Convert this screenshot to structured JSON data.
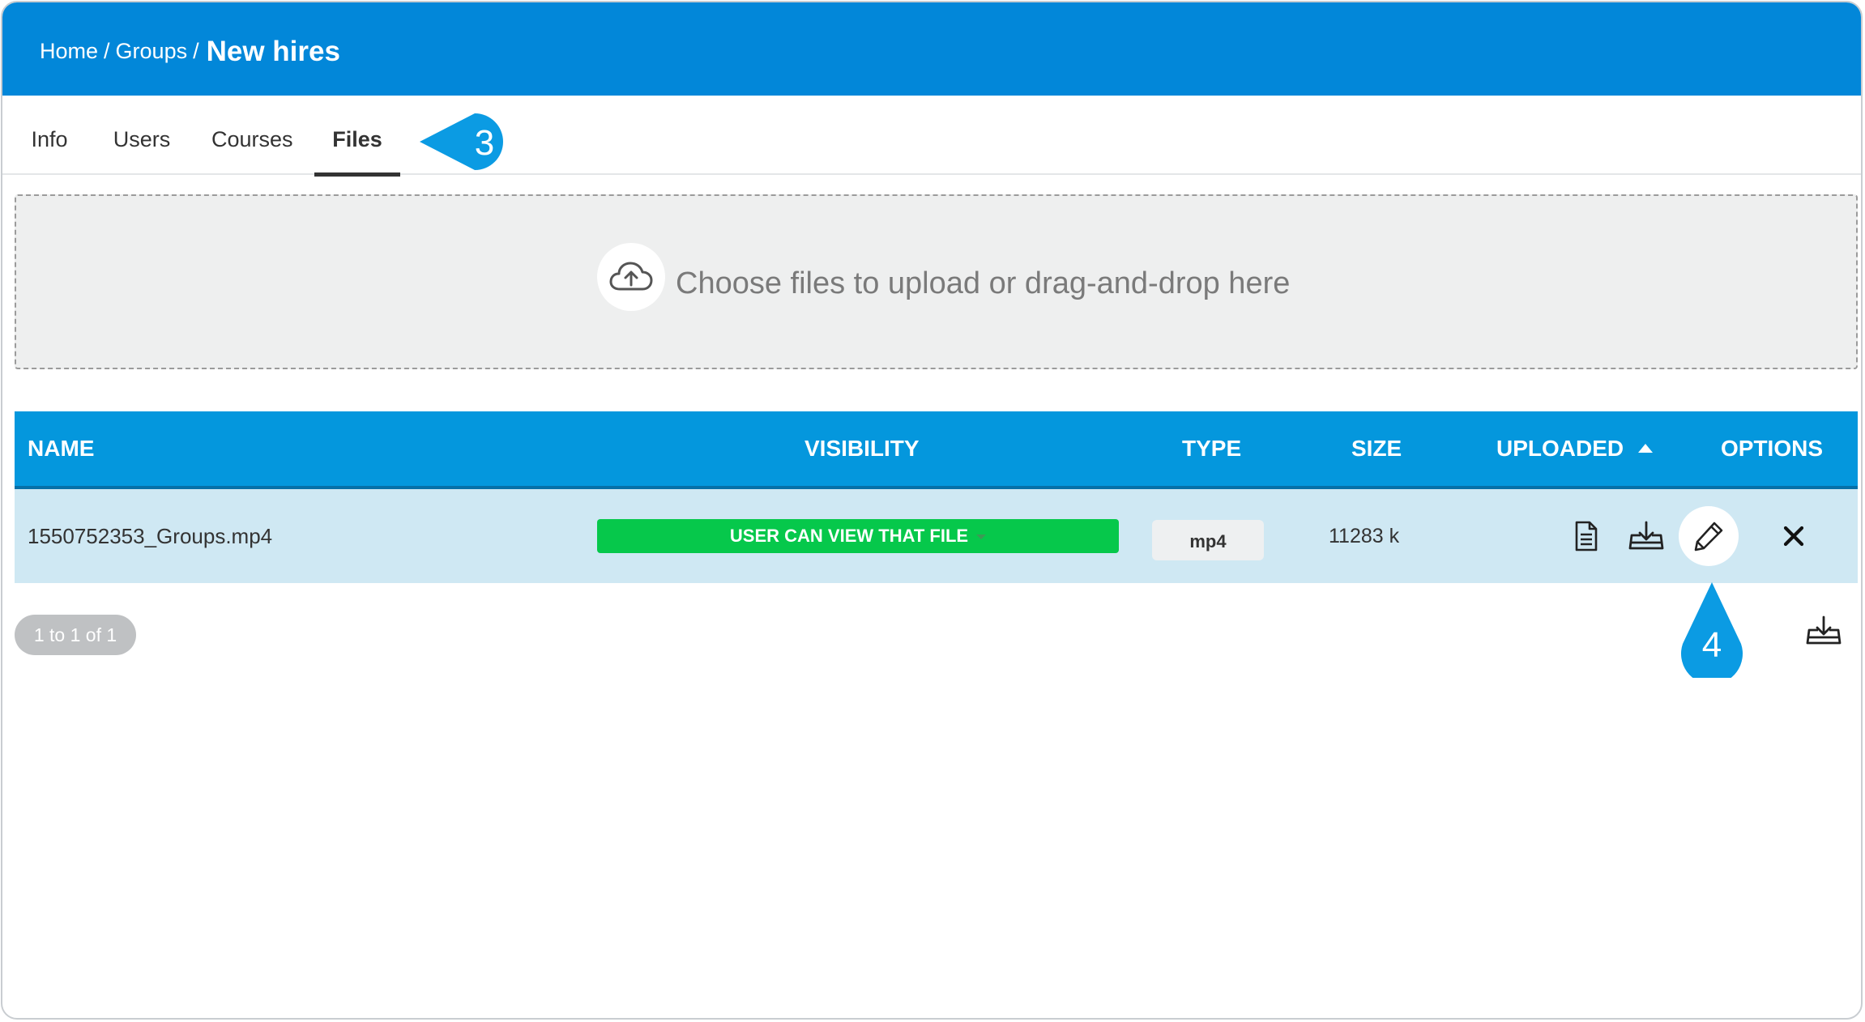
{
  "breadcrumb": {
    "home": "Home",
    "sep1": "/",
    "groups": "Groups",
    "sep2": "/",
    "current": "New hires"
  },
  "tabs": [
    {
      "label": "Info"
    },
    {
      "label": "Users"
    },
    {
      "label": "Courses"
    },
    {
      "label": "Files",
      "active": true
    }
  ],
  "callouts": {
    "step_files": "3",
    "step_edit": "4"
  },
  "upload": {
    "text": "Choose files to upload or drag-and-drop here",
    "icon": "cloud-upload-icon"
  },
  "table": {
    "headers": {
      "name": "NAME",
      "visibility": "VISIBILITY",
      "type": "TYPE",
      "size": "SIZE",
      "uploaded": "UPLOADED",
      "options": "OPTIONS"
    },
    "sort": {
      "column": "uploaded",
      "direction": "asc"
    },
    "rows": [
      {
        "name": "1550752353_Groups.mp4",
        "visibility": "USER CAN VIEW THAT FILE",
        "type": "mp4",
        "size": "11283 k",
        "options": [
          "preview-icon",
          "download-icon",
          "edit-icon",
          "delete-icon"
        ]
      }
    ]
  },
  "pagination": {
    "text": "1 to 1 of 1"
  },
  "export": {
    "icon": "download-icon"
  },
  "colors": {
    "header": "#0287d9",
    "table_header": "#0497dd",
    "row": "#cfe8f3",
    "visibility": "#06c84b",
    "callout": "#0b9be3"
  }
}
